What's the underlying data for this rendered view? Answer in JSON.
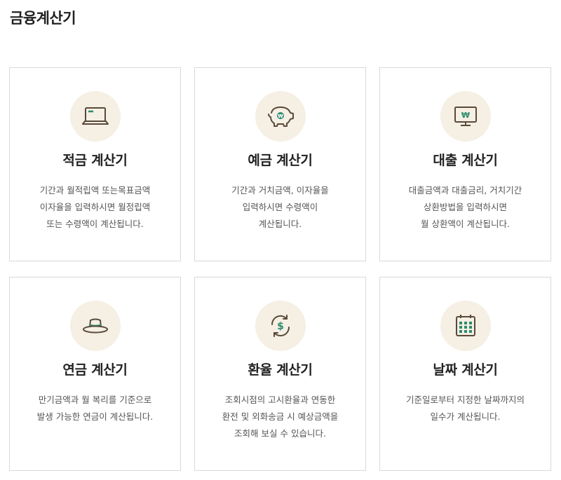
{
  "page": {
    "title": "금융계산기"
  },
  "colors": {
    "icon_bg": "#f5efe4",
    "icon_stroke": "#5a4a3a",
    "icon_accent": "#2e8b6e",
    "border": "#d9d9d9"
  },
  "cards": [
    {
      "icon": "laptop-icon",
      "title": "적금 계산기",
      "desc": [
        "기간과 월적립액 또는목표금액",
        "이자율을 입력하시면 월정립액",
        "또는 수령액이 계산됩니다."
      ]
    },
    {
      "icon": "piggy-bank-icon",
      "title": "예금 계산기",
      "desc": [
        "기간과 거치금액, 이자율을",
        "입력하시면 수령액이",
        "계산됩니다."
      ]
    },
    {
      "icon": "monitor-won-icon",
      "title": "대출 계산기",
      "desc": [
        "대출금액과 대출금리, 거치기간",
        "상환방법을 입력하시면",
        "월 상환액이 계산됩니다."
      ]
    },
    {
      "icon": "hat-icon",
      "title": "연금 계산기",
      "desc": [
        "만기금액과 월 복리를 기준으로",
        "발생 가능한 연금이 계산됩니다."
      ]
    },
    {
      "icon": "currency-exchange-icon",
      "title": "환율 계산기",
      "desc": [
        "조회시점의 고시환율과 연동한",
        "환전 및 외화송금 시 예상금액을",
        "조회해 보실 수 있습니다."
      ]
    },
    {
      "icon": "calendar-icon",
      "title": "날짜 계산기",
      "desc": [
        "기준일로부터 지정한 날짜까지의",
        "일수가 계산됩니다."
      ]
    }
  ]
}
